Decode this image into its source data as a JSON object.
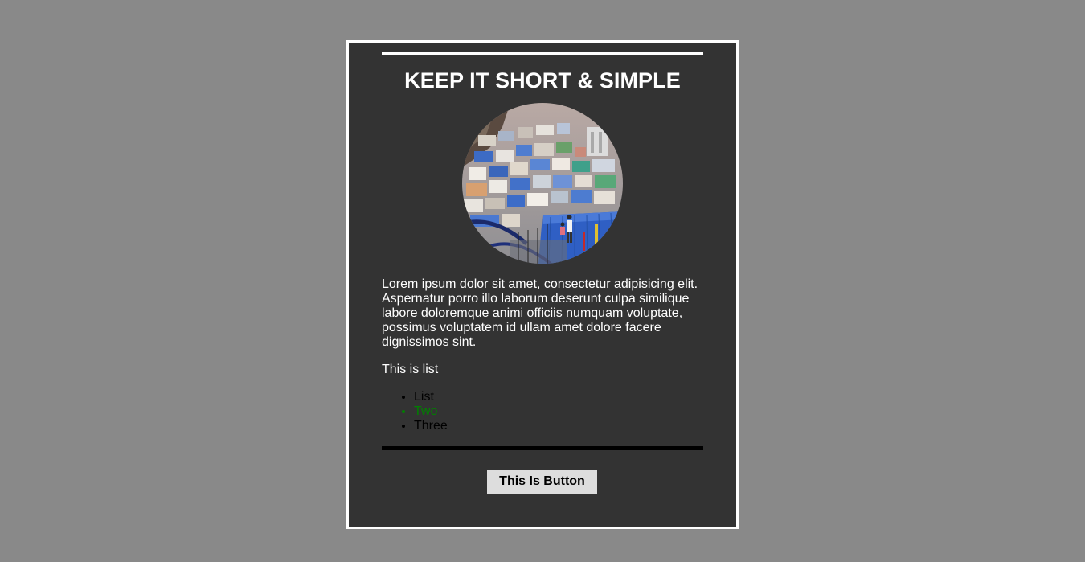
{
  "card": {
    "title": "KEEP IT SHORT & SIMPLE",
    "image": {
      "icon": "city-hillside-photo"
    },
    "paragraph": "Lorem ipsum dolor sit amet, consectetur adipisicing elit. Aspernatur porro illo laborum deserunt culpa similique labore doloremque animi officiis numquam voluptate, possimus voluptatem id ullam amet dolore facere dignissimos sint.",
    "list_caption": "This is list",
    "list_items": [
      "List",
      "Two",
      "Three"
    ],
    "button_label": "This Is Button"
  },
  "colors": {
    "page_background": "#898989",
    "card_background": "#333333",
    "card_border": "#ffffff",
    "accent_green": "#008000"
  }
}
